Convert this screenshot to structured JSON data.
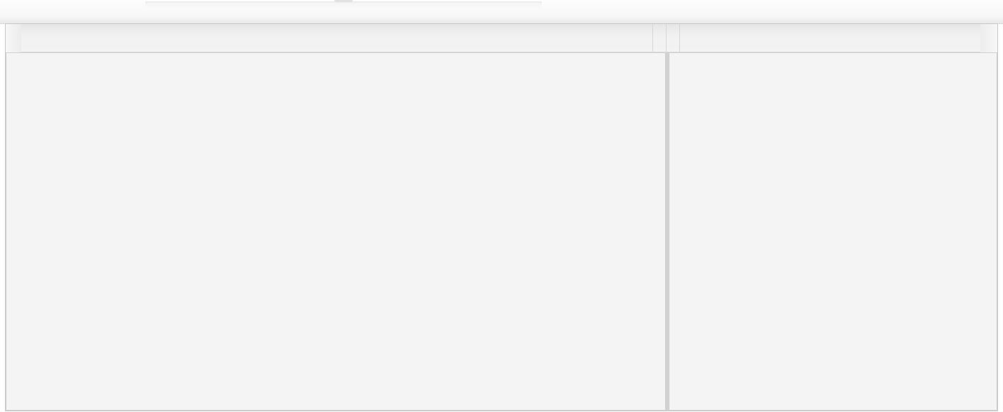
{
  "scene": {
    "subject": "vanity-cabinet",
    "colors": {
      "background": "#ffffff",
      "cabinet_front": "#f4f4f4",
      "countertop": "#f7f7f7",
      "outline": "#c8c8c8"
    }
  }
}
